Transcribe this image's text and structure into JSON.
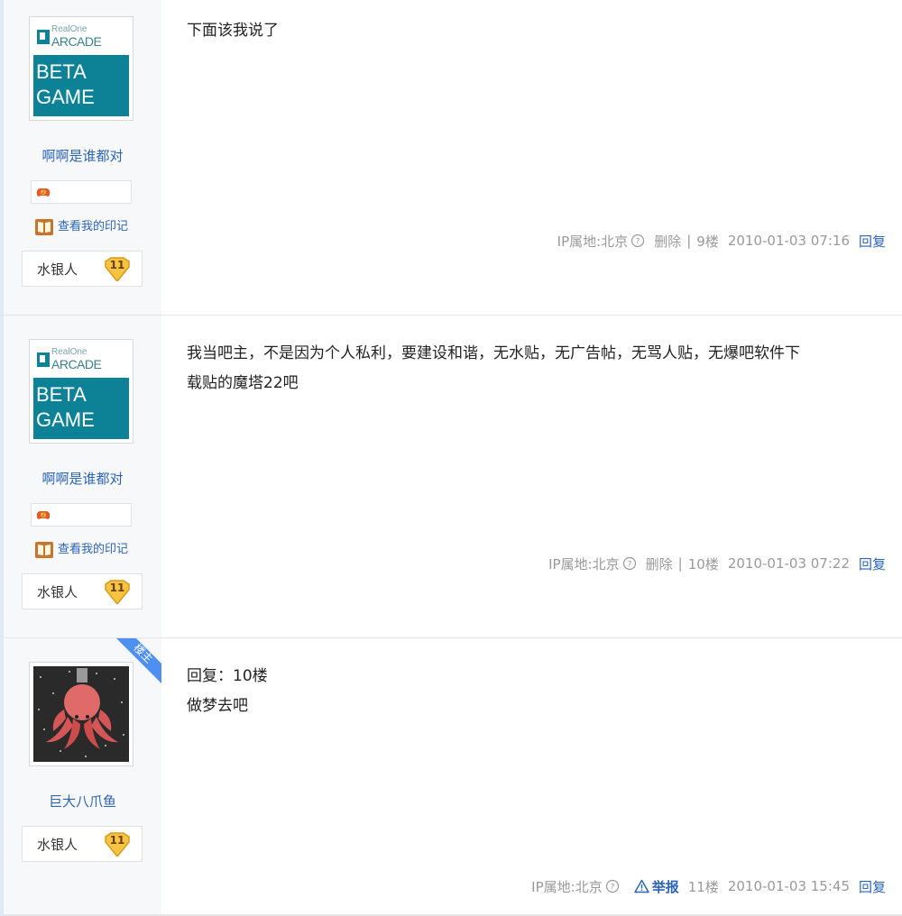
{
  "posts": [
    {
      "username": "啊啊是谁都对",
      "imprint_label": "查看我的印记",
      "level_title": "水银人",
      "level": "11",
      "avatar_brand_small": "RealOne",
      "avatar_brand": "ARCADE",
      "avatar_line1": "BETA",
      "avatar_line2": "GAME",
      "content_lines": [
        "下面该我说了"
      ],
      "ip": "IP属地:北京",
      "delete_label": "删除",
      "floor": "9楼",
      "time": "2010-01-03 07:16",
      "reply_label": "回复"
    },
    {
      "username": "啊啊是谁都对",
      "imprint_label": "查看我的印记",
      "level_title": "水银人",
      "level": "11",
      "avatar_brand_small": "RealOne",
      "avatar_brand": "ARCADE",
      "avatar_line1": "BETA",
      "avatar_line2": "GAME",
      "content_lines": [
        "我当吧主，不是因为个人私利，要建设和谐，无水贴，无广告帖，无骂人贴，无爆吧软件下",
        "载贴的魔塔22吧"
      ],
      "ip": "IP属地:北京",
      "delete_label": "删除",
      "floor": "10楼",
      "time": "2010-01-03 07:22",
      "reply_label": "回复"
    },
    {
      "owner_tag": "楼主",
      "username": "巨大八爪鱼",
      "level_title": "水银人",
      "level": "11",
      "content_lines": [
        "回复：10楼",
        "做梦去吧"
      ],
      "ip": "IP属地:北京",
      "report_label": "举报",
      "floor": "11楼",
      "time": "2010-01-03 15:45",
      "reply_label": "回复"
    }
  ],
  "colors": {
    "link": "#2d64b3",
    "meta": "#999999",
    "avatar_teal": "#0d8296",
    "owner_tag": "#4f8ff0"
  }
}
